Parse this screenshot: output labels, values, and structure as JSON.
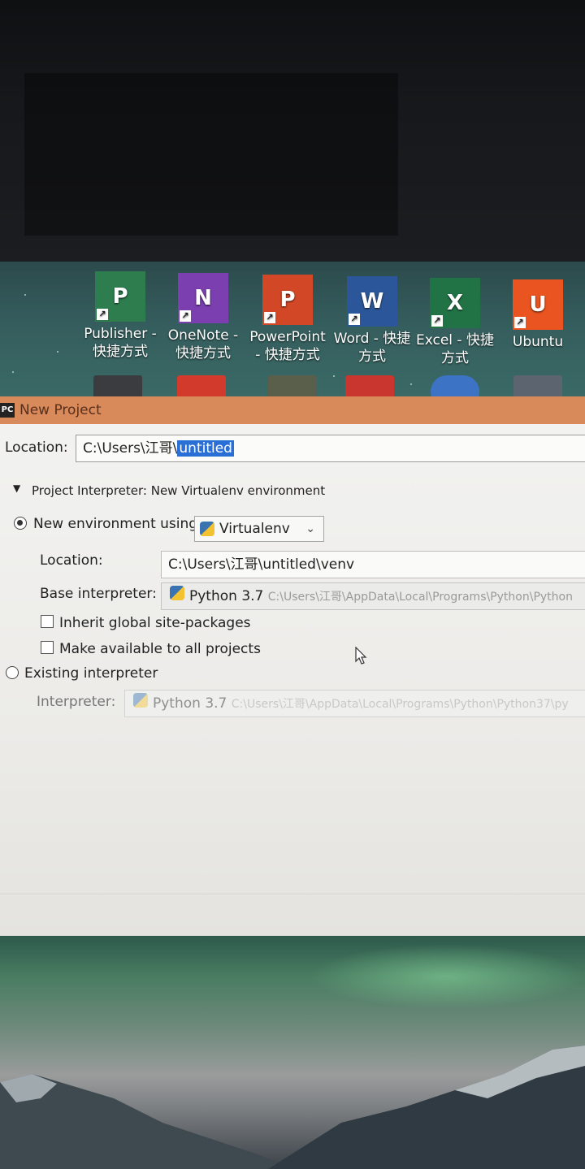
{
  "desktop": {
    "icons": [
      {
        "letter": "P",
        "label1": "Publisher -",
        "label2": "快捷方式",
        "color": "#2e7d4f"
      },
      {
        "letter": "N",
        "label1": "OneNote -",
        "label2": "快捷方式",
        "color": "#7b3fb0"
      },
      {
        "letter": "P",
        "label1": "PowerPoint",
        "label2": "- 快捷方式",
        "color": "#d24726"
      },
      {
        "letter": "W",
        "label1": "Word - 快捷",
        "label2": "方式",
        "color": "#2b579a"
      },
      {
        "letter": "X",
        "label1": "Excel - 快捷",
        "label2": "方式",
        "color": "#217346"
      },
      {
        "letter": "U",
        "label1": "Ubuntu",
        "label2": "",
        "color": "#e95420"
      }
    ]
  },
  "window": {
    "badge": "PC",
    "title": "New Project"
  },
  "form": {
    "location_label": "Location:",
    "location_prefix": "C:\\Users\\江哥\\",
    "location_selected": "untitled",
    "interpreter_section": "Project Interpreter: New Virtualenv environment",
    "new_env_label": "New environment using",
    "env_tool": "Virtualenv",
    "venv_location_label": "Location:",
    "venv_location_value": "C:\\Users\\江哥\\untitled\\venv",
    "base_interpreter_label": "Base interpreter:",
    "base_interpreter_name": "Python 3.7",
    "base_interpreter_path": "C:\\Users\\江哥\\AppData\\Local\\Programs\\Python\\Python",
    "inherit_label": "Inherit global site-packages",
    "make_available_label": "Make available to all projects",
    "existing_label": "Existing interpreter",
    "interpreter_label": "Interpreter:",
    "interpreter_name": "Python 3.7",
    "interpreter_path": "C:\\Users\\江哥\\AppData\\Local\\Programs\\Python\\Python37\\py"
  }
}
